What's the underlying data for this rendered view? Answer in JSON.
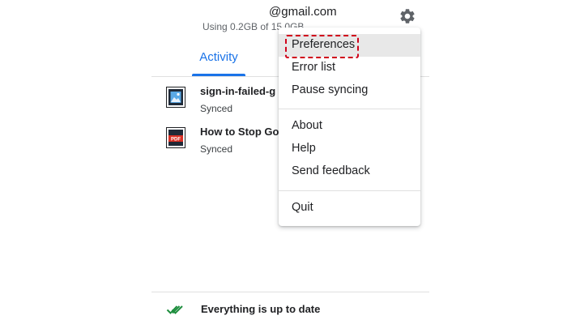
{
  "account": {
    "email": "@gmail.com",
    "usage": "Using 0.2GB of 15.0GB"
  },
  "tabs": [
    {
      "label": "Activity",
      "active": true
    }
  ],
  "files": [
    {
      "name": "sign-in-failed-g",
      "status": "Synced",
      "icon": "image-file-icon"
    },
    {
      "name": "How to Stop Go",
      "status": "Synced",
      "icon": "pdf-file-icon",
      "badge": "PDF"
    }
  ],
  "status": {
    "text": "Everything is up to date",
    "icon": "double-check-icon"
  },
  "menu": {
    "items": [
      {
        "label": "Preferences",
        "selected": true
      },
      {
        "label": "Error list"
      },
      {
        "label": "Pause syncing"
      },
      {
        "label": "About"
      },
      {
        "label": "Help"
      },
      {
        "label": "Send feedback"
      },
      {
        "label": "Quit"
      }
    ]
  },
  "colors": {
    "accent": "#1a73e8",
    "highlight": "#d0021b",
    "check": "#1e8e3e",
    "pdf": "#d93025"
  }
}
